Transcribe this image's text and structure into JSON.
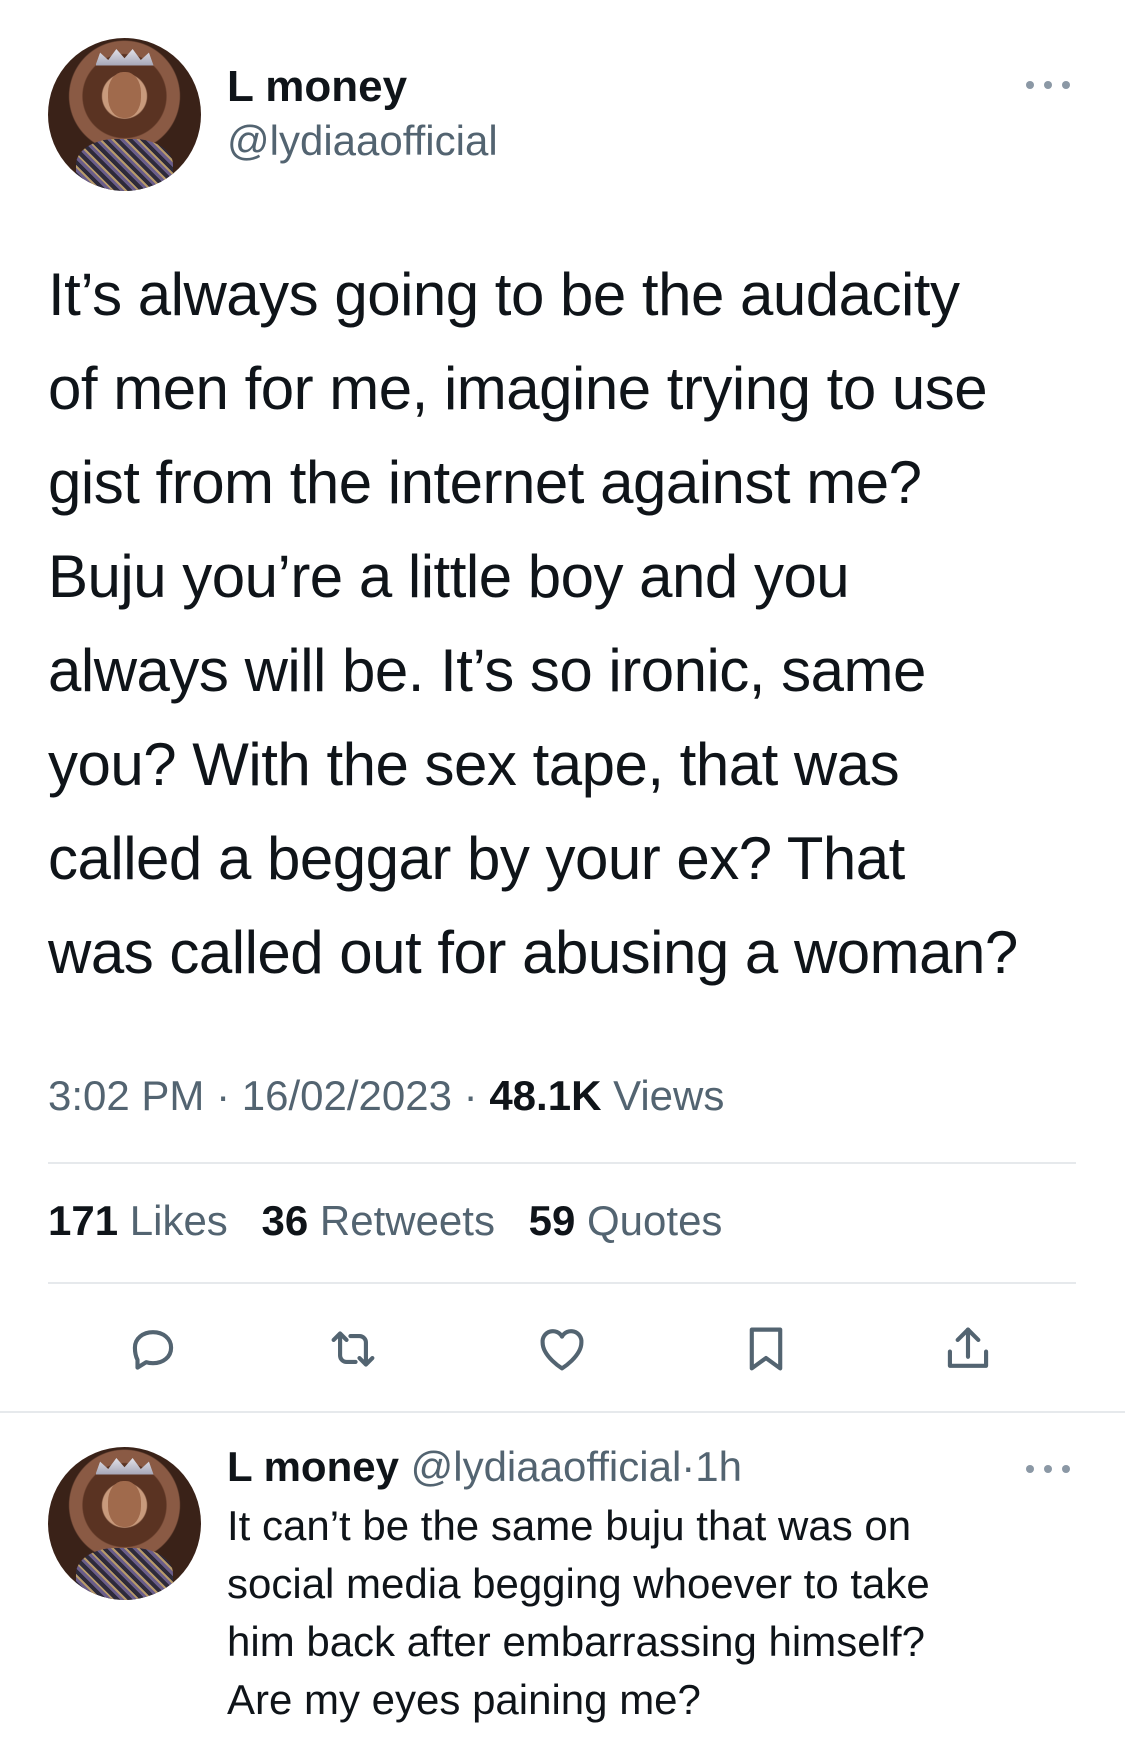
{
  "tweet": {
    "author_name": "L money",
    "author_handle": "@lydiaaofficial",
    "text": "It’s always going to be the audacity\nof men for me, imagine trying to use\ngist from the internet against me?\nBuju you’re a little boy and you\nalways will be. It’s so ironic, same\nyou? With the sex tape, that was\ncalled a beggar by your ex? That\nwas called out for abusing a woman?",
    "time": "3:02 PM",
    "date": "16/02/2023",
    "separator": "·",
    "views_count": "48.1K",
    "views_label": "Views",
    "stats": {
      "likes_count": "171",
      "likes_label": "Likes",
      "retweets_count": "36",
      "retweets_label": "Retweets",
      "quotes_count": "59",
      "quotes_label": "Quotes"
    },
    "actions": [
      "reply-icon",
      "retweet-icon",
      "like-icon",
      "bookmark-icon",
      "share-icon"
    ]
  },
  "reply": {
    "author_name": "L money",
    "author_handle": "@lydiaaofficial",
    "separator": "·",
    "time_ago": "1h",
    "text": "It can’t be the same buju that was on\nsocial media begging whoever to take\nhim back after embarrassing himself?\nAre my eyes paining me?"
  },
  "colors": {
    "text_primary": "#0f1419",
    "text_secondary": "#536471",
    "divider": "#e6e9ec",
    "icon": "#8b98a5",
    "action_icon": "#536471"
  }
}
